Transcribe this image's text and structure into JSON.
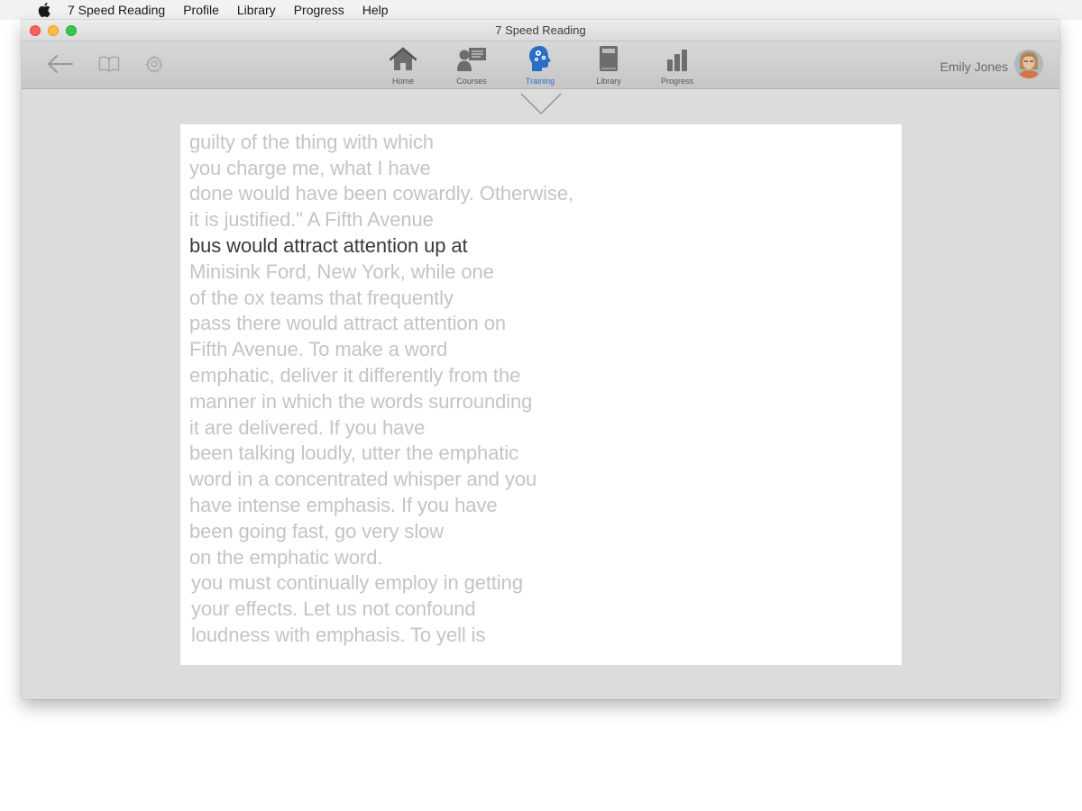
{
  "menubar": {
    "app_name": "7 Speed Reading",
    "items": [
      "Profile",
      "Library",
      "Progress",
      "Help"
    ]
  },
  "window": {
    "title": "7 Speed Reading"
  },
  "toolbar": {
    "left_icons": [
      "back-arrow-icon",
      "book-icon",
      "gear-icon"
    ],
    "nav": [
      {
        "label": "Home",
        "icon": "home-icon",
        "active": false
      },
      {
        "label": "Courses",
        "icon": "courses-icon",
        "active": false
      },
      {
        "label": "Training",
        "icon": "training-brain-icon",
        "active": true
      },
      {
        "label": "Library",
        "icon": "library-book-icon",
        "active": false
      },
      {
        "label": "Progress",
        "icon": "progress-bars-icon",
        "active": false
      }
    ],
    "user_name": "Emily Jones"
  },
  "colors": {
    "active_accent": "#2a6ec8",
    "text_dim": "#c4c4c4",
    "text_focus": "#3a3a3a"
  },
  "reading": {
    "focus_index": 4,
    "lines": [
      "guilty of the thing with which",
      "you charge me, what I have",
      "done would have been cowardly. Otherwise,",
      "it is justified.\" A Fifth Avenue",
      "bus would attract attention up at",
      "Minisink Ford, New York, while one",
      "of the ox teams that frequently",
      "pass there would attract attention on",
      "Fifth Avenue. To make a word",
      "emphatic, deliver it differently from the",
      "manner in which the words surrounding",
      "it are delivered. If you have",
      "been talking loudly, utter the emphatic",
      "word in a concentrated whisper and you",
      "have intense emphasis. If you have",
      "been going fast, go very slow",
      "on the emphatic word.",
      "you must continually employ in getting",
      "your effects. Let us not confound",
      "loudness with emphasis. To yell is"
    ]
  }
}
